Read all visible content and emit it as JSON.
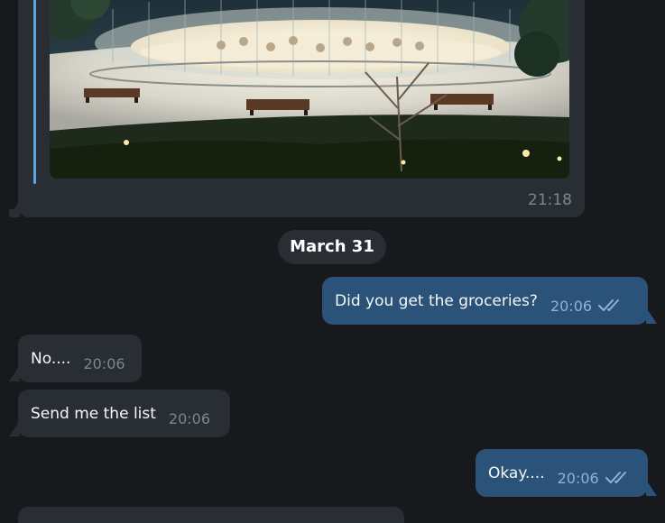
{
  "media_message": {
    "time": "21:18"
  },
  "date_separator": "March 31",
  "messages": [
    {
      "direction": "outgoing",
      "text": "Did you get the groceries?",
      "time": "20:06",
      "status": "read-double-check"
    },
    {
      "direction": "incoming",
      "text": "No....",
      "time": "20:06"
    },
    {
      "direction": "incoming",
      "text": "Send me the list",
      "time": "20:06"
    },
    {
      "direction": "outgoing",
      "text": "Okay....",
      "time": "20:06",
      "status": "read-double-check"
    }
  ],
  "colors": {
    "background": "#18191d",
    "incoming_bubble": "#282e33",
    "outgoing_bubble": "#2b5278",
    "quote_accent": "#5ea6e0",
    "read_check": "#8eb3d6"
  }
}
